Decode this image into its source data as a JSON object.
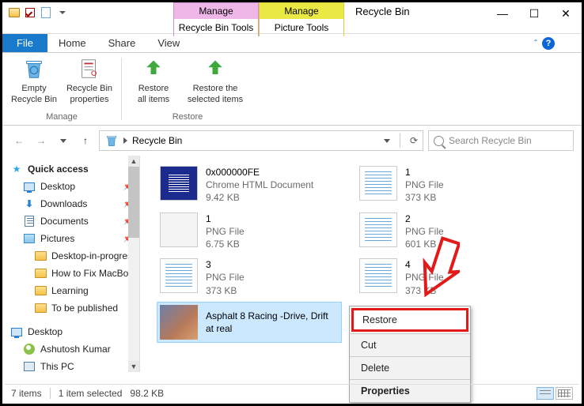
{
  "window": {
    "title": "Recycle Bin"
  },
  "context_tabs": [
    {
      "group": "Manage",
      "tool": "Recycle Bin Tools"
    },
    {
      "group": "Manage",
      "tool": "Picture Tools"
    }
  ],
  "tabs": {
    "file": "File",
    "home": "Home",
    "share": "Share",
    "view": "View"
  },
  "ribbon": {
    "manage": {
      "label": "Manage",
      "empty": "Empty\nRecycle Bin",
      "props": "Recycle Bin\nproperties"
    },
    "restore": {
      "label": "Restore",
      "all": "Restore\nall items",
      "selected": "Restore the\nselected items"
    }
  },
  "address": {
    "location": "Recycle Bin"
  },
  "search": {
    "placeholder": "Search Recycle Bin"
  },
  "sidebar": {
    "quick": "Quick access",
    "items": [
      {
        "icon": "desktop",
        "label": "Desktop",
        "pinned": true
      },
      {
        "icon": "downloads",
        "label": "Downloads",
        "pinned": true
      },
      {
        "icon": "documents",
        "label": "Documents",
        "pinned": true
      },
      {
        "icon": "pictures",
        "label": "Pictures",
        "pinned": true
      },
      {
        "icon": "folder",
        "label": "Desktop-in-progres"
      },
      {
        "icon": "folder",
        "label": "How to Fix MacBoo"
      },
      {
        "icon": "folder",
        "label": "Learning"
      },
      {
        "icon": "folder",
        "label": "To be published"
      }
    ],
    "desktop": "Desktop",
    "sub": [
      {
        "icon": "avatar",
        "label": "Ashutosh Kumar"
      },
      {
        "icon": "pc",
        "label": "This PC"
      }
    ]
  },
  "files": [
    {
      "name": "0x000000FE",
      "type": "Chrome HTML Document",
      "size": "9.42 KB",
      "thumb": "html"
    },
    {
      "name": "1",
      "type": "PNG File",
      "size": "373 KB",
      "thumb": "png"
    },
    {
      "name": "1",
      "type": "PNG File",
      "size": "6.75 KB",
      "thumb": "ac"
    },
    {
      "name": "2",
      "type": "PNG File",
      "size": "601 KB",
      "thumb": "png"
    },
    {
      "name": "3",
      "type": "PNG File",
      "size": "373 KB",
      "thumb": "png"
    },
    {
      "name": "4",
      "type": "PNG File",
      "size": "373 KB",
      "thumb": "png"
    },
    {
      "name": "Asphalt 8 Racing -Drive, Drift at real",
      "type": "",
      "size": "",
      "thumb": "photo",
      "selected": true
    }
  ],
  "context_menu": {
    "restore": "Restore",
    "cut": "Cut",
    "delete": "Delete",
    "properties": "Properties"
  },
  "status": {
    "count": "7 items",
    "selection": "1 item selected",
    "size": "98.2 KB"
  }
}
